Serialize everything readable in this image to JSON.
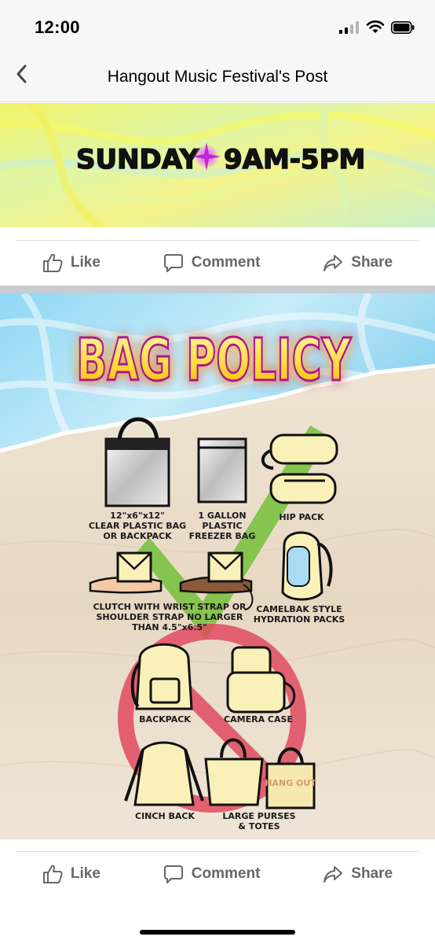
{
  "status_bar": {
    "time": "12:00"
  },
  "nav": {
    "title": "Hangout Music Festival's Post"
  },
  "post1": {
    "banner_text_left": "SUNDAY",
    "banner_text_right": "9AM-5PM"
  },
  "actions": {
    "like": "Like",
    "comment": "Comment",
    "share": "Share"
  },
  "post2": {
    "title": "BAG POLICY",
    "items": {
      "clear_bag": [
        "12\"x6\"x12\"",
        "CLEAR PLASTIC BAG",
        "OR BACKPACK"
      ],
      "freezer_bag": [
        "1 GALLON",
        "PLASTIC",
        "FREEZER BAG"
      ],
      "hip_pack": [
        "HIP PACK"
      ],
      "clutch": [
        "CLUTCH WITH WRIST STRAP OR",
        "SHOULDER STRAP NO LARGER",
        "THAN 4.5\"x6.5\""
      ],
      "camelbak": [
        "CAMELBAK STYLE",
        "HYDRATION PACKS"
      ],
      "backpack": [
        "BACKPACK"
      ],
      "camera_case": [
        "CAMERA CASE"
      ],
      "cinch_back": [
        "CINCH BACK"
      ],
      "large_purses": [
        "LARGE PURSES",
        "& TOTES"
      ],
      "tote_logo": "HANG OUT"
    }
  },
  "colors": {
    "action_text": "#65676b",
    "separator": "#c9ccd1",
    "title_fill": "#fde047",
    "title_glow": "#d946ef",
    "allowed_check": "#7bc142",
    "prohibited": "#e04a5f"
  }
}
